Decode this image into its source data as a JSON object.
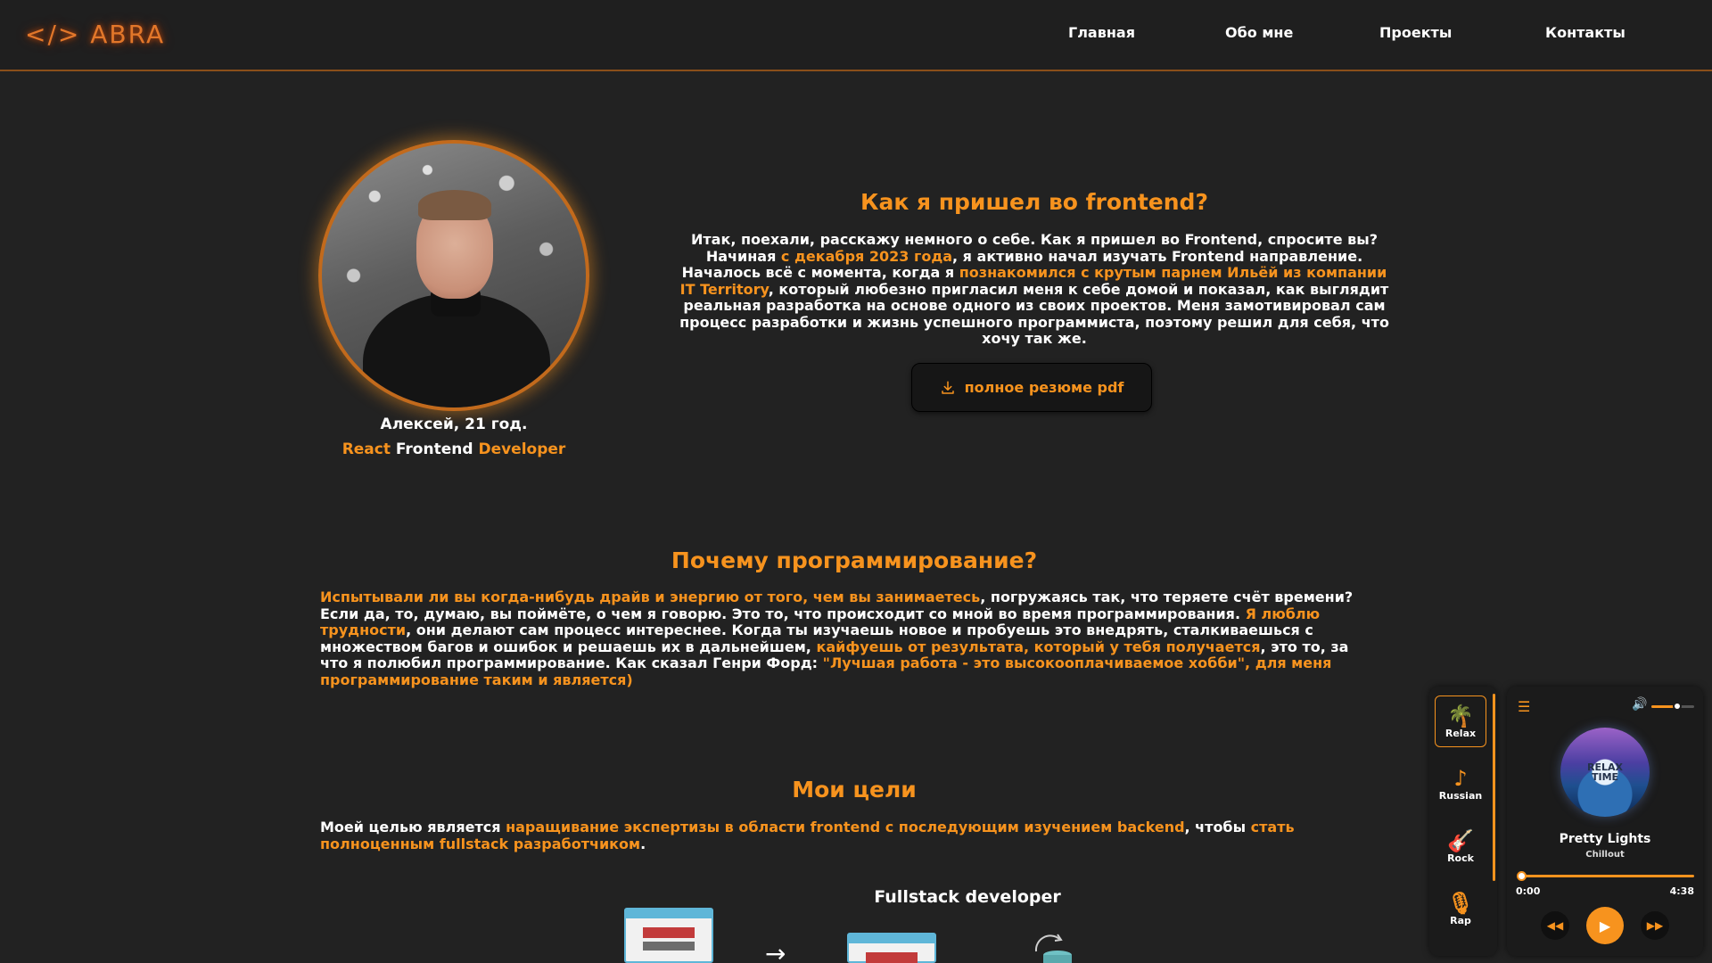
{
  "header": {
    "logo": "</> ABRA",
    "nav": [
      {
        "label": "Главная"
      },
      {
        "label": "Обо мне"
      },
      {
        "label": "Проекты"
      },
      {
        "label": "Контакты"
      }
    ]
  },
  "colors": {
    "accent": "#f7931e",
    "background": "#222222",
    "header_border": "#8a4f1a"
  },
  "profile": {
    "name_age": "Алексей, 21 год.",
    "role_part1": "React",
    "role_part2": " Frontend ",
    "role_part3": "Developer"
  },
  "about": {
    "title": "Как я пришел во frontend?",
    "text": [
      {
        "t": "Итак, поехали, расскажу немного о себе. Как я пришел во Frontend, спросите вы? Начиная ",
        "h": false
      },
      {
        "t": "с декабря 2023 года",
        "h": true
      },
      {
        "t": ", я активно начал изучать Frontend направление. Началось всё с момента, когда я ",
        "h": false
      },
      {
        "t": "познакомился с крутым парнем Ильёй из компании IT Territory",
        "h": true
      },
      {
        "t": ", который любезно пригласил меня к себе домой и показал, как выглядит реальная разработка на основе одного из своих проектов. Меня замотивировал сам процесс разработки и жизнь успешного программиста, поэтому решил для себя, что хочу так же.",
        "h": false
      }
    ],
    "pdf_button": "полное резюме pdf",
    "pdf_icon": "download-icon"
  },
  "why": {
    "title": "Почему программирование?",
    "text": [
      {
        "t": "Испытывали ли вы когда-нибудь драйв и энергию от того, чем вы занимаетесь",
        "h": true
      },
      {
        "t": ", погружаясь так, что теряете счёт времени? Если да, то, думаю, вы поймёте, о чем я говорю. Это то, что происходит со мной во время программирования. ",
        "h": false
      },
      {
        "t": "Я люблю трудности",
        "h": true
      },
      {
        "t": ", они делают сам процесс интереснее. Когда ты изучаешь новое и пробуешь это внедрять, сталкиваешься с множеством багов и ошибок и решаешь их в дальнейшем, ",
        "h": false
      },
      {
        "t": "кайфуешь от результата, который у тебя получается",
        "h": true
      },
      {
        "t": ", это то, за что я полюбил программирование. Как сказал Генри Форд: ",
        "h": false
      },
      {
        "t": "\"Лучшая работа - это высокооплачиваемое хобби\", для меня программирование таким и является)",
        "h": true
      }
    ]
  },
  "goals": {
    "title": "Мои цели",
    "text": [
      {
        "t": "Моей целью является ",
        "h": false
      },
      {
        "t": "наращивание экспертизы в области frontend с последующим изучением backend",
        "h": true
      },
      {
        "t": ", чтобы ",
        "h": false
      },
      {
        "t": "стать полноценным fullstack разработчиком",
        "h": true
      },
      {
        "t": ".",
        "h": false
      }
    ],
    "diagram_title": "Fullstack developer",
    "arrow": "→"
  },
  "player": {
    "genres": [
      {
        "label": "Relax",
        "icon": "palm-tree-icon",
        "glyph": "🌴",
        "active": true
      },
      {
        "label": "Russian",
        "icon": "balalaika-icon",
        "glyph": "♪",
        "active": false
      },
      {
        "label": "Rock",
        "icon": "guitar-icon",
        "glyph": "🎸",
        "active": false
      },
      {
        "label": "Rap",
        "icon": "microphone-icon",
        "glyph": "🎙",
        "active": false
      }
    ],
    "cover_text": "RELAX\nTIME",
    "track_title": "Pretty Lights",
    "track_genre": "Chillout",
    "time_current": "0:00",
    "time_total": "4:38",
    "progress": 0.0,
    "volume": 0.6
  }
}
